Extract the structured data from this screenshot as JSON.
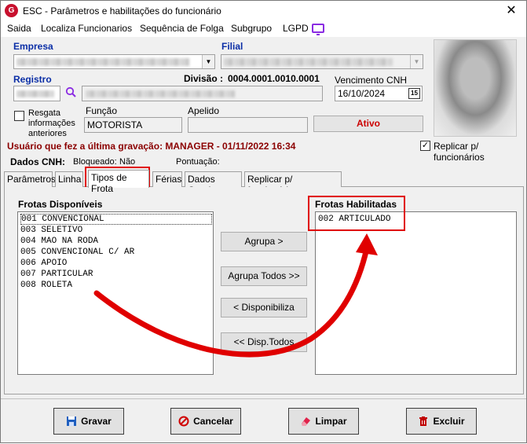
{
  "window": {
    "title": "ESC - Parâmetros e habilitações do funcionário",
    "logo_text": "G"
  },
  "menu": [
    "Saida",
    "Localiza Funcionarios",
    "Sequência de Folga",
    "Subgrupo",
    "LGPD"
  ],
  "form": {
    "empresa_label": "Empresa",
    "filial_label": "Filial",
    "registro_label": "Registro",
    "divisao_label": "Divisão :",
    "divisao_value": "0004.0001.0010.0001",
    "vencimento_label": "Vencimento CNH",
    "vencimento_value": "16/10/2024",
    "calendar_label": "15",
    "resgata_label": "Resgata informações anteriores",
    "funcao_label": "Função",
    "funcao_value": "MOTORISTA",
    "apelido_label": "Apelido",
    "apelido_value": "",
    "status_value": "Ativo",
    "save_info": "Usuário que fez a última gravação: MANAGER - 01/11/2022 16:34",
    "replicar_label": "Replicar p/ funcionários",
    "replicar_checked": "✓"
  },
  "cnh": {
    "label": "Dados CNH:",
    "bloqueado_label": "Bloqueado:",
    "bloqueado_value": "Não",
    "pontuacao_label": "Pontuação:"
  },
  "tabs": [
    "Parâmetros",
    "Linha",
    "Tipos de Frota",
    "Férias",
    "Dados Gerais",
    "Replicar p/ funcionários"
  ],
  "frotas": {
    "disponiveis_label": "Frotas Disponíveis",
    "disponiveis": [
      "001 CONVENCIONAL",
      "003 SELETIVO",
      "004 MAO NA RODA",
      "005 CONVENCIONAL C/ AR",
      "006 APOIO",
      "007 PARTICULAR",
      "008 ROLETA"
    ],
    "habilitadas_label": "Frotas Habilitadas",
    "habilitadas": [
      "002 ARTICULADO"
    ]
  },
  "actions": {
    "agrupa": "Agrupa >",
    "agrupa_todos": "Agrupa Todos >>",
    "disponibiliza": "< Disponibiliza",
    "disp_todos": "<< Disp.Todos"
  },
  "footer": {
    "gravar": "Gravar",
    "cancelar": "Cancelar",
    "limpar": "Limpar",
    "excluir": "Excluir"
  },
  "colors": {
    "accent_blue": "#0a2ea6",
    "highlight_red": "#e00000",
    "status_red": "#cc0000",
    "save_info": "#8b0000"
  }
}
